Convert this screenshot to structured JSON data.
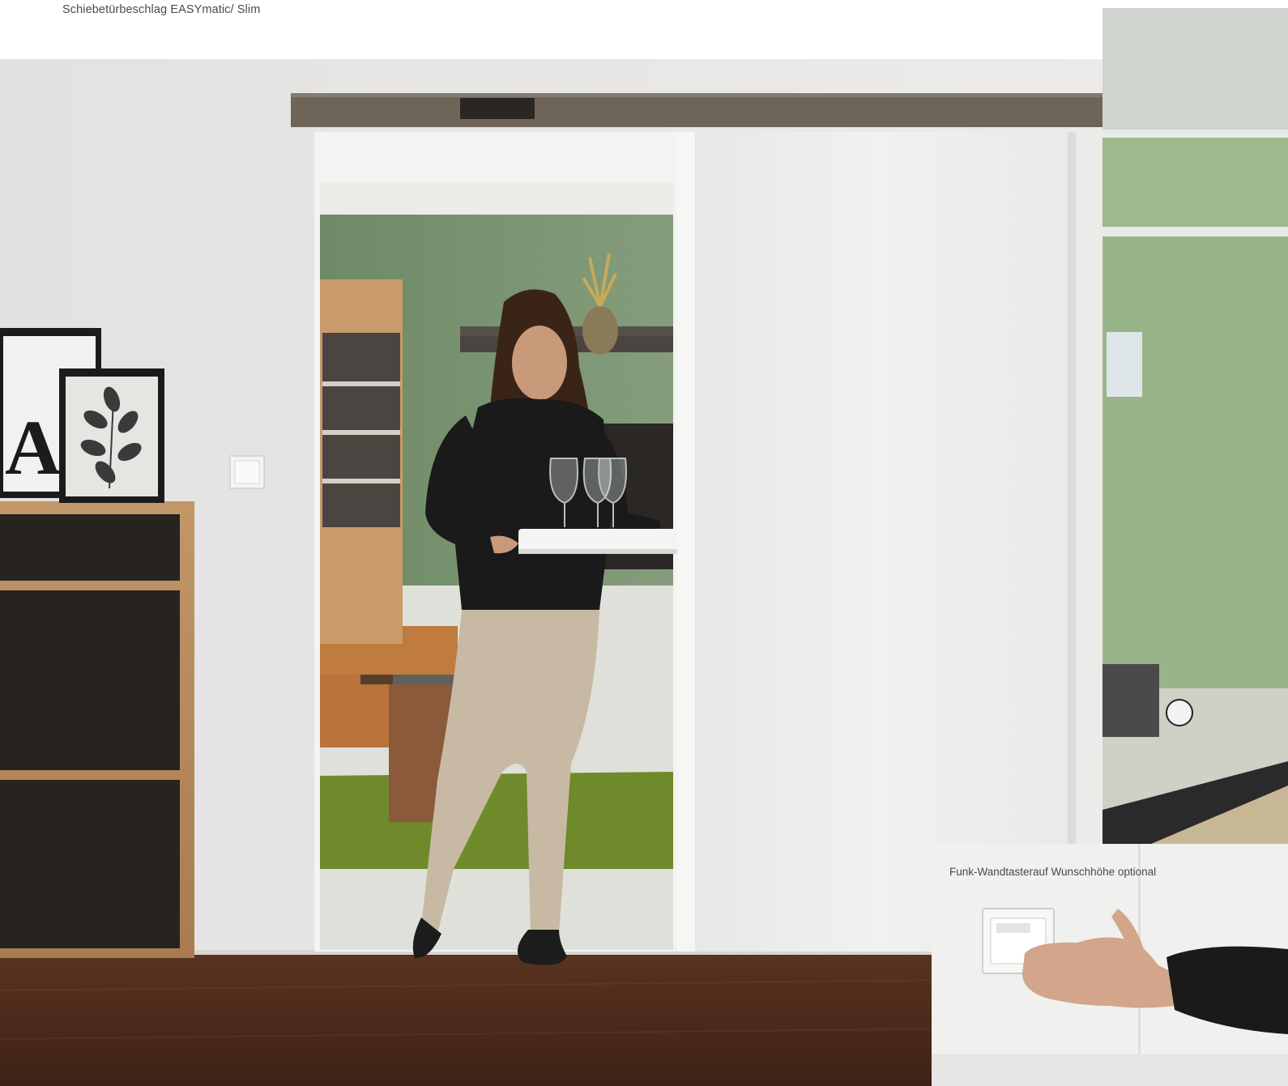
{
  "header": {
    "title": "Schiebetürbeschlag EASYmatic/ Slim"
  },
  "inset": {
    "caption": "Funk-Wandtasterauf Wunschhöhe optional"
  },
  "art": {
    "poster_letter": "A"
  },
  "colors": {
    "wall": "#e7e7e5",
    "track": "#6f6458",
    "floor": "#4a2a1a",
    "green_wall": "#7a9472",
    "rug": "#6e8a2a",
    "glass_door": "#ececea",
    "cabinet": "#262321",
    "oak": "#b8895a"
  }
}
